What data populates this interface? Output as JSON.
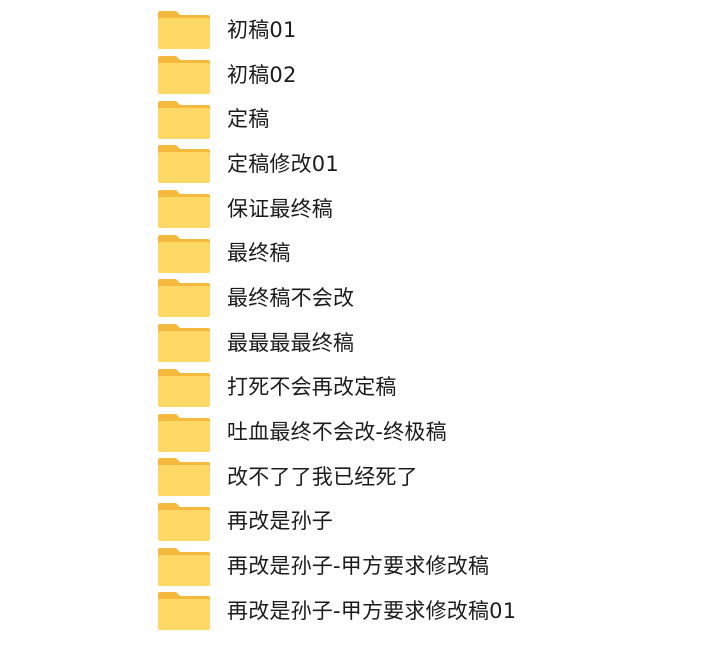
{
  "folders": [
    {
      "name": "初稿01"
    },
    {
      "name": "初稿02"
    },
    {
      "name": "定稿"
    },
    {
      "name": "定稿修改01"
    },
    {
      "name": "保证最终稿"
    },
    {
      "name": "最终稿"
    },
    {
      "name": "最终稿不会改"
    },
    {
      "name": "最最最最终稿"
    },
    {
      "name": "打死不会再改定稿"
    },
    {
      "name": "吐血最终不会改-终极稿"
    },
    {
      "name": "改不了了我已经死了"
    },
    {
      "name": "再改是孙子"
    },
    {
      "name": "再改是孙子-甲方要求修改稿"
    },
    {
      "name": "再改是孙子-甲方要求修改稿01"
    }
  ],
  "icon": {
    "name": "folder-icon",
    "back_color": "#F5B93E",
    "front_color": "#FFD866"
  }
}
